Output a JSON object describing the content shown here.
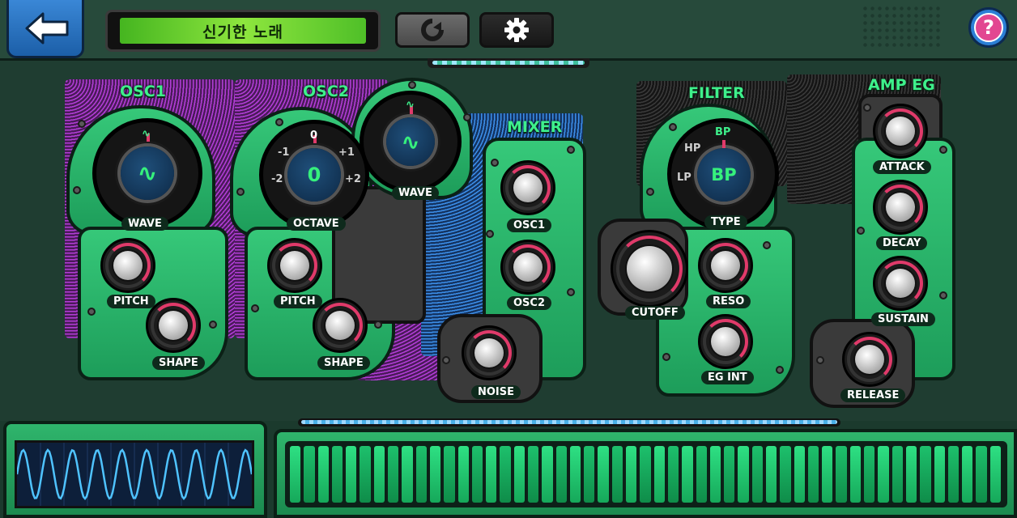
{
  "header": {
    "song_title": "신기한 노래",
    "help_symbol": "?"
  },
  "icons": {
    "back": "arrow-left-icon",
    "reset": "refresh-icon",
    "settings": "gear-icon",
    "help": "question-icon"
  },
  "sections": {
    "osc1": "OSC1",
    "osc2": "OSC2",
    "mixer": "MIXER",
    "filter": "FILTER",
    "amp_eg": "AMP EG"
  },
  "osc1": {
    "wave_label": "WAVE",
    "wave_value": "∿",
    "wave_marker": "∿",
    "pitch_label": "PITCH",
    "shape_label": "SHAPE"
  },
  "osc2": {
    "octave_label": "OCTAVE",
    "octave_value": "0",
    "octave_options": [
      "-2",
      "-1",
      "0",
      "+1",
      "+2"
    ],
    "wave_label": "WAVE",
    "wave_value": "∿",
    "wave_marker": "∿",
    "pitch_label": "PITCH",
    "shape_label": "SHAPE"
  },
  "mixer": {
    "osc1_label": "OSC1",
    "osc2_label": "OSC2",
    "noise_label": "NOISE"
  },
  "filter": {
    "type_label": "TYPE",
    "type_value": "BP",
    "type_options": [
      "HP",
      "BP",
      "LP"
    ],
    "cutoff_label": "CUTOFF",
    "reso_label": "RESO",
    "eg_int_label": "EG INT"
  },
  "amp_eg": {
    "attack_label": "ATTACK",
    "decay_label": "DECAY",
    "sustain_label": "SUSTAIN",
    "release_label": "RELEASE"
  },
  "colors": {
    "panel_green": "#2ec273",
    "label_green": "#3ef08b",
    "knob_accent": "#e03a6a",
    "lcd_green": "#7edc3a",
    "scope_wave": "#4fc3ff"
  },
  "keyboard": {
    "key_count": 25
  }
}
